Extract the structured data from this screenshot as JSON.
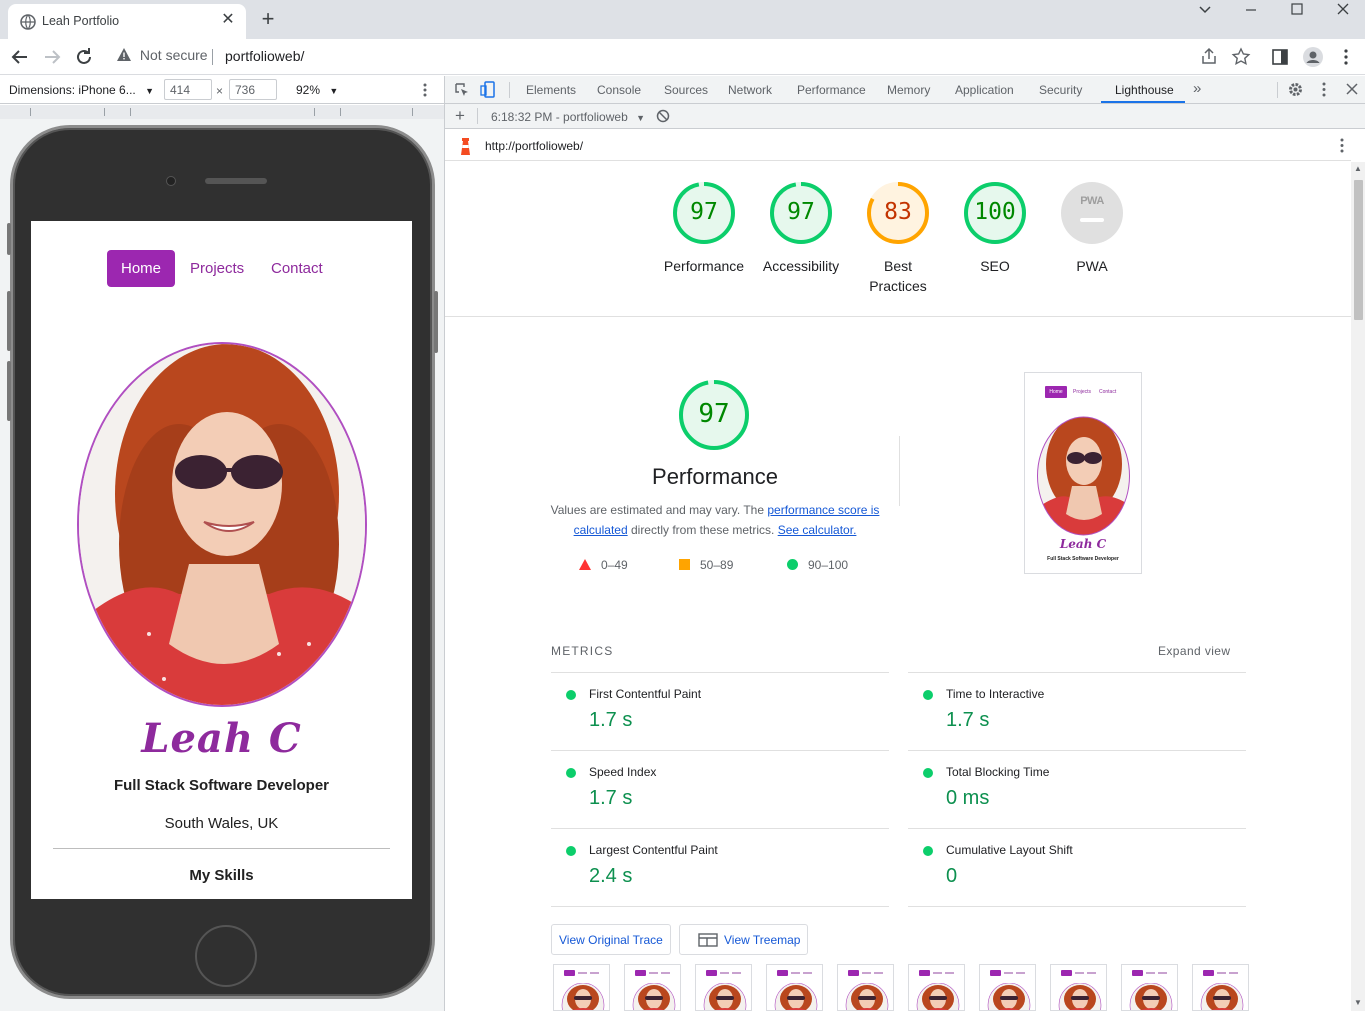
{
  "browser": {
    "tab_title": "Leah Portfolio",
    "address_security": "Not secure",
    "address_url": "portfolioweb/"
  },
  "device_toolbar": {
    "dimensions_label": "Dimensions: iPhone 6...",
    "width": "414",
    "height": "736",
    "times": "×",
    "zoom": "92%"
  },
  "portfolio": {
    "nav": [
      "Home",
      "Projects",
      "Contact"
    ],
    "name_signature": "Leah C",
    "role": "Full Stack Software Developer",
    "location": "South Wales, UK",
    "section_heading": "My Skills"
  },
  "devtools": {
    "tabs": [
      "Elements",
      "Console",
      "Sources",
      "Network",
      "Performance",
      "Memory",
      "Application",
      "Security",
      "Lighthouse"
    ],
    "more_tabs": "»",
    "report_selector": "6:18:32 PM - portfolioweb",
    "report_url": "http://portfolioweb/"
  },
  "lighthouse": {
    "scores": [
      {
        "label": "Performance",
        "score": "97",
        "value": 97,
        "status": "pass"
      },
      {
        "label": "Accessibility",
        "score": "97",
        "value": 97,
        "status": "pass"
      },
      {
        "label": "Best Practices",
        "score": "83",
        "value": 83,
        "status": "average"
      },
      {
        "label": "SEO",
        "score": "100",
        "value": 100,
        "status": "pass"
      },
      {
        "label": "PWA",
        "score": "PWA",
        "value": null,
        "status": "na"
      }
    ],
    "performance": {
      "score": "97",
      "value": 97,
      "title": "Performance",
      "desc_prefix": "Values are estimated and may vary. The ",
      "desc_link1": "performance score is calculated",
      "desc_middle": " directly from these metrics. ",
      "desc_link2": "See calculator."
    },
    "legend": [
      {
        "range": "0–49",
        "color": "#ff3333"
      },
      {
        "range": "50–89",
        "color": "#ffa400"
      },
      {
        "range": "90–100",
        "color": "#0cce6b"
      }
    ],
    "metrics_heading": "METRICS",
    "expand_view": "Expand view",
    "metrics": [
      {
        "name": "First Contentful Paint",
        "value": "1.7 s"
      },
      {
        "name": "Time to Interactive",
        "value": "1.7 s"
      },
      {
        "name": "Speed Index",
        "value": "1.7 s"
      },
      {
        "name": "Total Blocking Time",
        "value": "0 ms"
      },
      {
        "name": "Largest Contentful Paint",
        "value": "2.4 s"
      },
      {
        "name": "Cumulative Layout Shift",
        "value": "0"
      }
    ],
    "buttons": {
      "trace": "View Original Trace",
      "treemap": "View Treemap"
    },
    "screenshot": {
      "nav": [
        "Home",
        "Projects",
        "Contact"
      ],
      "name": "Leah C",
      "role": "Full Stack Software Developer"
    }
  },
  "colors": {
    "pass": "#0cce6b",
    "pass_text": "#008800",
    "average": "#ffa400",
    "average_text": "#c33300",
    "fail": "#ff3333",
    "brand_purple": "#9c27b0",
    "link_blue": "#1558d6"
  }
}
